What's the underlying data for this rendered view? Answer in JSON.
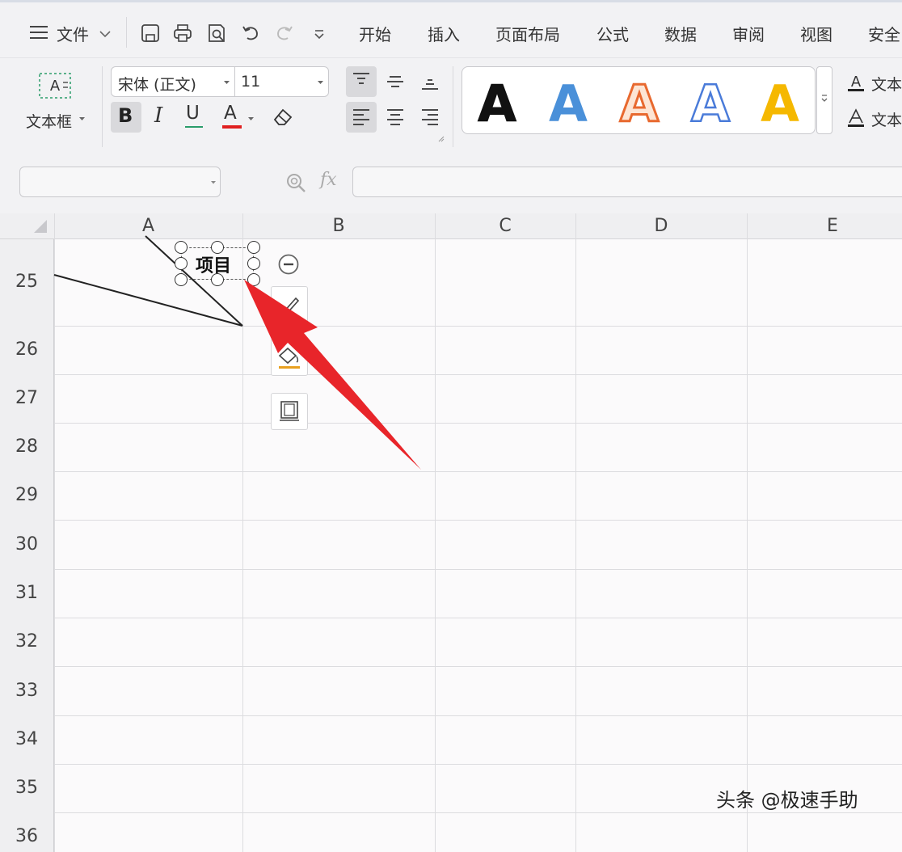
{
  "menubar": {
    "file_label": "文件",
    "tabs": [
      "开始",
      "插入",
      "页面布局",
      "公式",
      "数据",
      "审阅",
      "视图",
      "安全"
    ]
  },
  "ribbon": {
    "textbox_label": "文本框",
    "font_name": "宋体 (正文)",
    "font_size": "11",
    "bold_label": "B",
    "italic_label": "I",
    "underline_label": "U",
    "font_color_label": "A",
    "font_color": "#e02020",
    "style_letter": "A",
    "style_colors": [
      "#111111",
      "#4a90d9",
      "#e8692f",
      "#4a7bd9",
      "#f5b800"
    ],
    "text_fill_label": "文本",
    "text_outline_label": "文本"
  },
  "formula_bar": {
    "fx_label": "fx",
    "name_box_value": "",
    "formula_value": ""
  },
  "sheet": {
    "columns": [
      "A",
      "B",
      "C",
      "D",
      "E"
    ],
    "rows": [
      "25",
      "26",
      "27",
      "28",
      "29",
      "30",
      "31",
      "32",
      "33",
      "34",
      "35",
      "36"
    ],
    "textbox_text": "项目"
  },
  "annotation_color": "#e8252a",
  "watermark": "头条 @极速手助"
}
